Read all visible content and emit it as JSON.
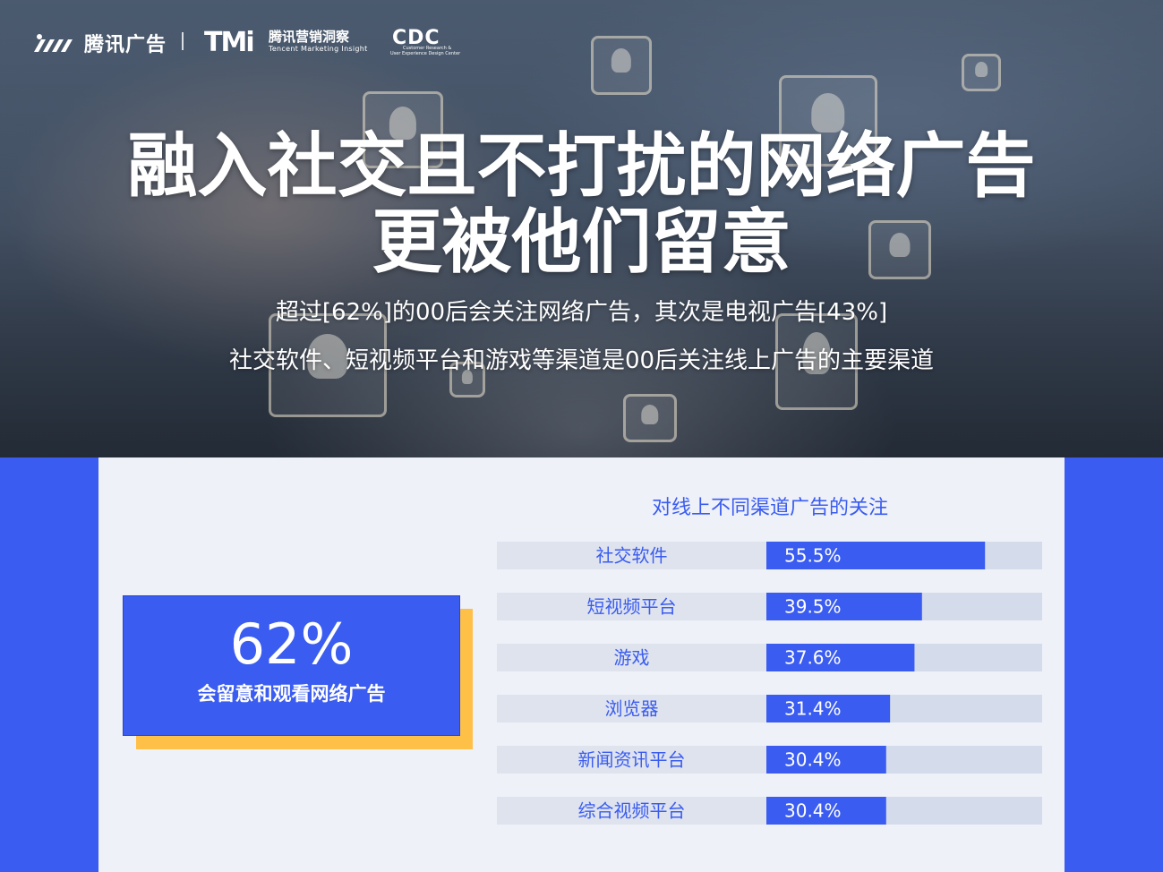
{
  "header": {
    "brand_name": "腾讯广告",
    "brand2_mark": "TMi",
    "brand2_name": "腾讯营销洞察",
    "brand2_sub": "Tencent Marketing Insight",
    "brand3_mark": "CDC",
    "brand3_sub1": "Customer Research &",
    "brand3_sub2": "User Experience Design Center"
  },
  "hero": {
    "title_line1": "融入社交且不打扰的网络广告",
    "title_line2": "更被他们留意",
    "subtitle_line1": "超过[62%]的00后会关注网络广告，其次是电视广告[43%]",
    "subtitle_line2": "社交软件、短视频平台和游戏等渠道是00后关注线上广告的主要渠道"
  },
  "callout": {
    "value": "62%",
    "label": "会留意和观看网络广告"
  },
  "colors": {
    "accent": "#3a5cf0",
    "accent_shadow": "#ffc048",
    "bar_track": "#d4dcec",
    "label_bg": "#dee3ee",
    "panel_bg": "#eef1f8"
  },
  "chart_data": {
    "type": "bar",
    "orientation": "horizontal",
    "title": "对线上不同渠道广告的关注",
    "categories": [
      "社交软件",
      "短视频平台",
      "游戏",
      "浏览器",
      "新闻资讯平台",
      "综合视频平台"
    ],
    "values": [
      55.5,
      39.5,
      37.6,
      31.4,
      30.4,
      30.4
    ],
    "value_labels": [
      "55.5%",
      "39.5%",
      "37.6%",
      "31.4%",
      "30.4%",
      "30.4%"
    ],
    "xlim": [
      0,
      70
    ],
    "unit": "%"
  }
}
